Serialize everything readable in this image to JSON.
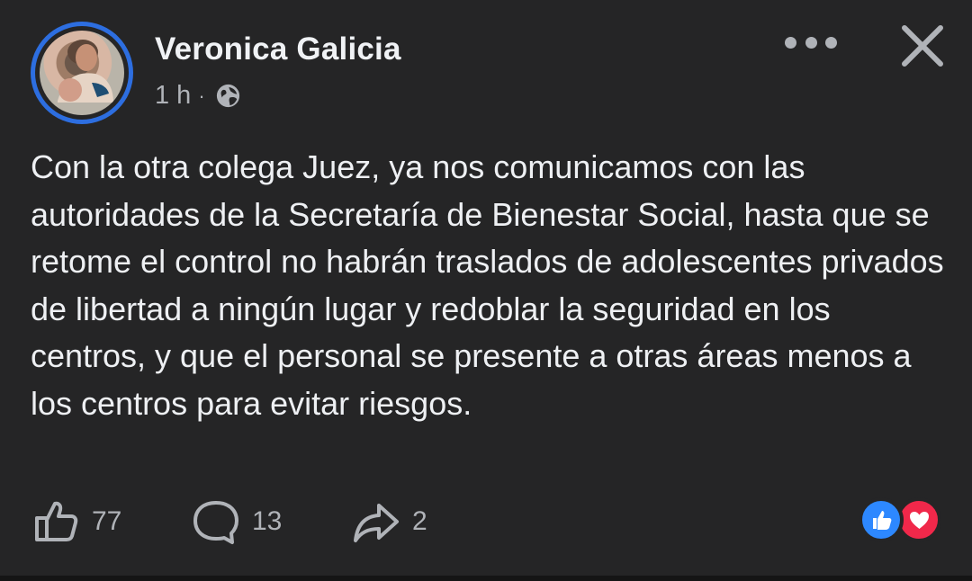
{
  "post": {
    "author": "Veronica Galicia",
    "time": "1 h",
    "separator": "·",
    "privacy_icon": "globe-icon",
    "text": "Con la otra colega Juez, ya nos comunicamos con las autoridades de la Secretaría de Bienestar Social, hasta que se retome el control no habrán traslados de adolescentes privados de libertad a ningún lugar y redoblar la seguridad en los centros, y que el personal se presente a otras áreas menos a los centros para evitar riesgos."
  },
  "actions": {
    "like_count": "77",
    "comment_count": "13",
    "share_count": "2"
  },
  "reactions": [
    "like-reaction-icon",
    "love-reaction-icon"
  ],
  "colors": {
    "background": "#252526",
    "avatar_ring": "#2d6ee0",
    "like_reaction": "#2d88ff",
    "love_reaction": "#f0284a"
  }
}
